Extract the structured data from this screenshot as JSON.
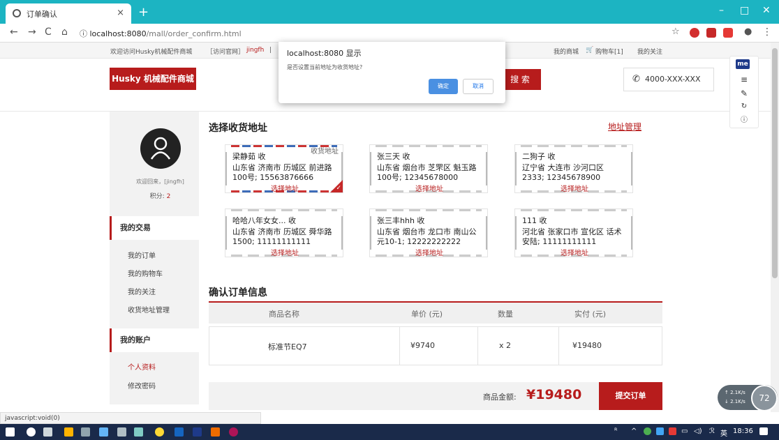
{
  "browser": {
    "tab_title": "订单确认",
    "url_scheme": "ⓘ",
    "url_host": "localhost:8080",
    "url_path": "/mall/order_confirm.html",
    "status_text": "javascript:void(0)"
  },
  "topbar": {
    "welcome": "欢迎访问Husky机械配件商城",
    "visit_site": "［访问官网］",
    "username": "jingfh",
    "sep": "|",
    "my_mall": "我的商城",
    "cart": "购物车[1]",
    "my_follow": "我的关注"
  },
  "header": {
    "logo": "Husky 机械配件商城",
    "search_button": "搜 索",
    "phone": "4000-XXX-XXX"
  },
  "dialog": {
    "title": "localhost:8080 显示",
    "message": "是否设置当前地址为收货地址?",
    "ok": "确定",
    "cancel": "取消"
  },
  "sidebar": {
    "welcome": "欢迎回来，[jingfh]",
    "points_label": "积分:",
    "points_value": "2",
    "section_trade": "我的交易",
    "trade_items": [
      "我的订单",
      "我的购物车",
      "我的关注",
      "收货地址管理"
    ],
    "section_account": "我的账户",
    "account_items": [
      "个人资料",
      "修改密码"
    ]
  },
  "address_section": {
    "title": "选择收货地址",
    "manage_link": "地址管理",
    "default_tag": "收货地址",
    "pick_label": "选择地址",
    "cards": [
      {
        "name": "梁静茹  收",
        "addr": "山东省 济南市 历城区 前进路100号; 15563876666",
        "selected": true
      },
      {
        "name": "张三天  收",
        "addr": "山东省 烟台市 芝罘区 魁玉路100号; 12345678000",
        "selected": false
      },
      {
        "name": "二狗子  收",
        "addr": "辽宁省 大连市 沙河口区 2333; 12345678900",
        "selected": false
      },
      {
        "name": "哈哈八年女女...  收",
        "addr": "山东省 济南市 历城区 舜华路1500; 11111111111",
        "selected": false
      },
      {
        "name": "张三丰hhh  收",
        "addr": "山东省 烟台市 龙口市 南山公元10-1; 12222222222",
        "selected": false
      },
      {
        "name": "111  收",
        "addr": "河北省 张家口市 宣化区 话术安陆; 11111111111",
        "selected": false
      }
    ]
  },
  "order_section": {
    "title": "确认订单信息",
    "headers": [
      "商品名称",
      "单价 (元)",
      "数量",
      "实付 (元)"
    ],
    "row": {
      "name": "标准节EQ7",
      "price": "¥9740",
      "qty": "x 2",
      "paid": "¥19480"
    },
    "total_label": "商品金额:",
    "total_value": "¥19480",
    "submit": "提交订单"
  },
  "ext_panel": {
    "me": "me"
  },
  "speed": {
    "up": "↑ 2.1K/s",
    "down": "↓ 2.1K/s",
    "percent": "72"
  },
  "taskbar": {
    "lang": "英",
    "time": "18:36"
  },
  "colors": {
    "accent": "#b71c1c",
    "chrome": "#1cb4c2",
    "taskbar": "#1a2a4a"
  }
}
